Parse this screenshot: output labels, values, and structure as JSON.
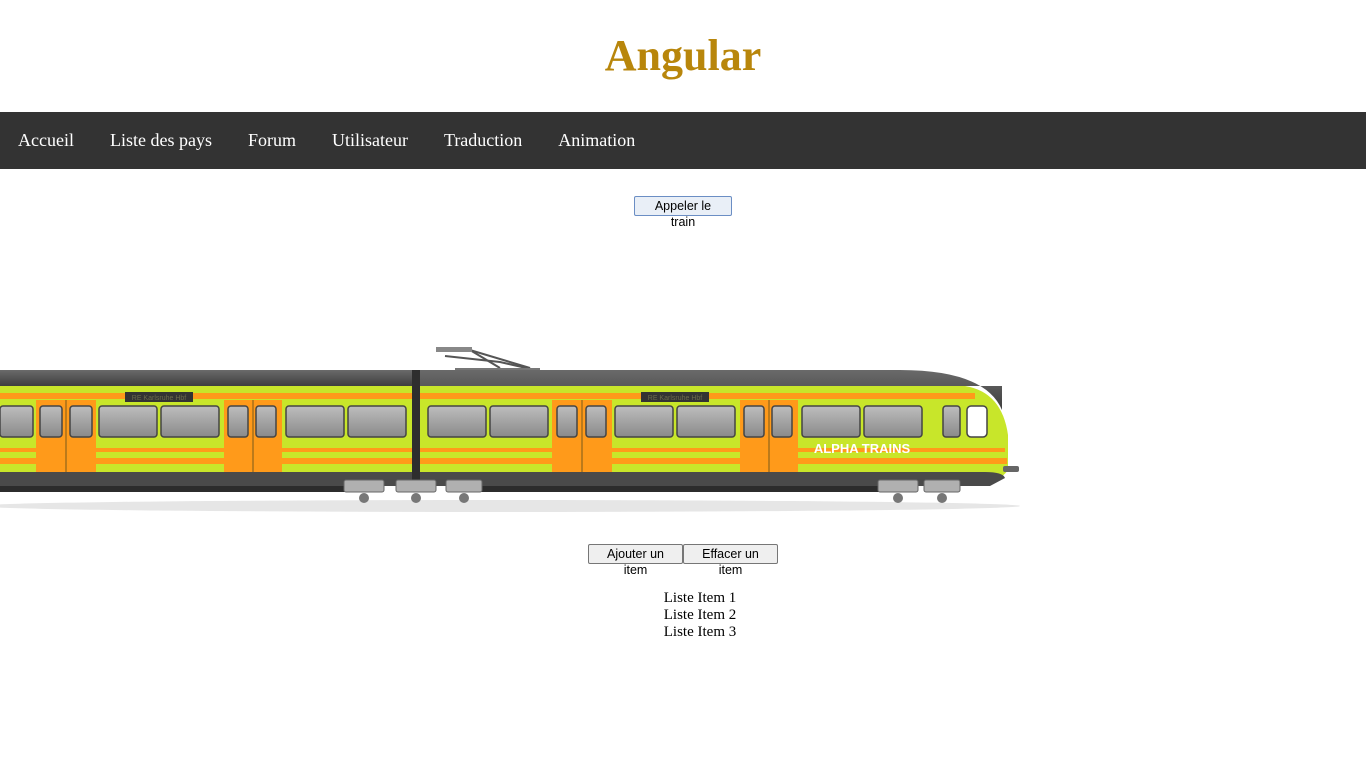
{
  "page": {
    "title": "Angular"
  },
  "nav": {
    "items": [
      {
        "label": "Accueil"
      },
      {
        "label": "Liste des pays"
      },
      {
        "label": "Forum"
      },
      {
        "label": "Utilisateur"
      },
      {
        "label": "Traduction"
      },
      {
        "label": "Animation"
      }
    ]
  },
  "controls": {
    "call_train_label": "Appeler le train",
    "add_item_label": "Ajouter un item",
    "remove_item_label": "Effacer un item"
  },
  "train": {
    "brand": "ALPHA TRAINS",
    "destination_sign": "RE Karlsruhe Hbf",
    "colors": {
      "lime": "#c8e62a",
      "orange": "#ff9a1a",
      "roof": "#4a4a4a"
    }
  },
  "list": {
    "items": [
      "Liste Item 1",
      "Liste Item 2",
      "Liste Item 3"
    ]
  },
  "colors": {
    "title": "#b8860b",
    "navbar": "#333333",
    "nav_text": "#ffffff"
  }
}
